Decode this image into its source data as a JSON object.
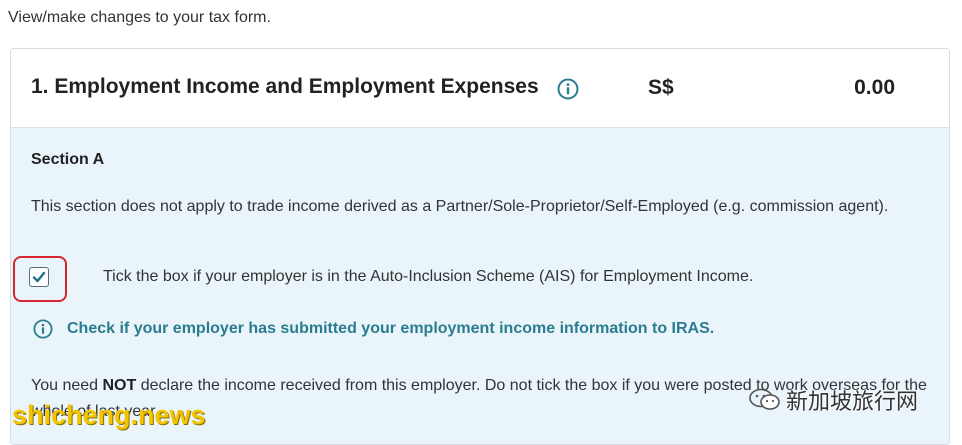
{
  "intro_text": "View/make changes to your tax form.",
  "header": {
    "title": "1. Employment Income and Employment Expenses",
    "currency": "S$",
    "amount": "0.00"
  },
  "section": {
    "title": "Section A",
    "description": "This section does not apply to trade income derived as a Partner/Sole-Proprietor/Self-Employed (e.g. commission agent).",
    "ais_checkbox": {
      "checked": true,
      "label": "Tick the box if your employer is in the Auto-Inclusion Scheme (AIS) for Employment Income."
    },
    "check_link": "Check if your employer has submitted your employment income information to IRAS.",
    "notice": {
      "prefix": "You need ",
      "emphasis": "NOT",
      "suffix": " declare the income received from this employer. Do not tick the box if you were posted to work overseas for the whole of last year."
    }
  },
  "watermark": "shicheng.news",
  "brand_text": "新加坡旅行网",
  "colors": {
    "body_bg": "#eaf5fb",
    "link": "#2a7d8f",
    "highlight": "#d9262c",
    "watermark": "#f5c400"
  }
}
